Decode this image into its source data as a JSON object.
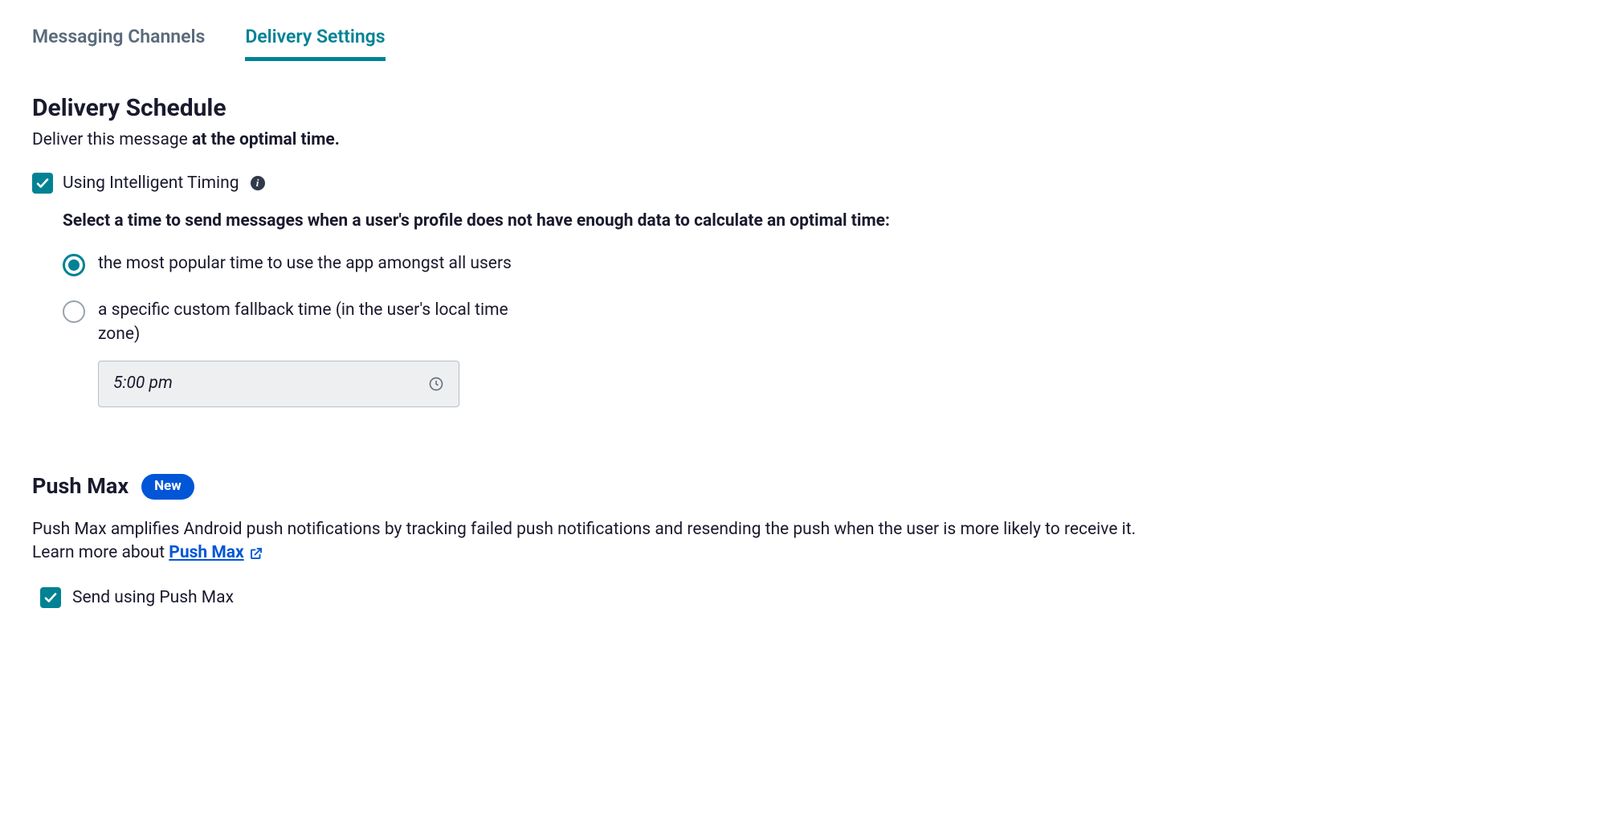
{
  "tabs": {
    "messaging": "Messaging Channels",
    "delivery": "Delivery Settings"
  },
  "schedule": {
    "title": "Delivery Schedule",
    "subtitle_prefix": "Deliver this message ",
    "subtitle_bold": "at the optimal time.",
    "intelligent_label": "Using Intelligent Timing",
    "fallback_prompt": "Select a time to send messages when a user's profile does not have enough data to calculate an optimal time:",
    "radio_popular": "the most popular time to use the app amongst all users",
    "radio_custom": "a specific custom fallback time (in the user's local time zone)",
    "time_value": "5:00 pm"
  },
  "pushmax": {
    "title": "Push Max",
    "badge": "New",
    "description_prefix": "Push Max amplifies Android push notifications by tracking failed push notifications and resending the push when the user is more likely to receive it. Learn more about ",
    "link_text": "Push Max",
    "checkbox_label": "Send using Push Max"
  }
}
